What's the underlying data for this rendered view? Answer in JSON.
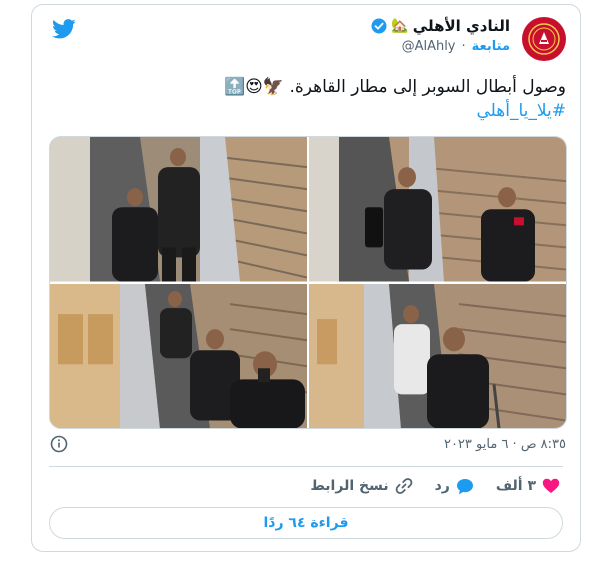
{
  "account": {
    "name": "النادي الأهلي",
    "name_emoji": "🏡",
    "handle": "@AlAhly",
    "follow_label": "متابعة",
    "separator": "·"
  },
  "tweet": {
    "text": "وصول أبطال السوبر إلى مطار القاهرة.",
    "emojis": "🦅😍🔝",
    "hashtag": "#يلا_يا_أهلي",
    "timestamp": "٨:٣٥ ص · ٦ مايو ٢٠٢٣"
  },
  "actions": {
    "like_count": "٣ ألف",
    "reply_label": "رد",
    "copy_link_label": "نسخ الرابط",
    "read_replies_label": "قراءة ٦٤ ردًا"
  },
  "colors": {
    "accent": "#1d9bf0",
    "like": "#f91880",
    "club_red": "#c8102e",
    "border": "#cfd9de"
  }
}
